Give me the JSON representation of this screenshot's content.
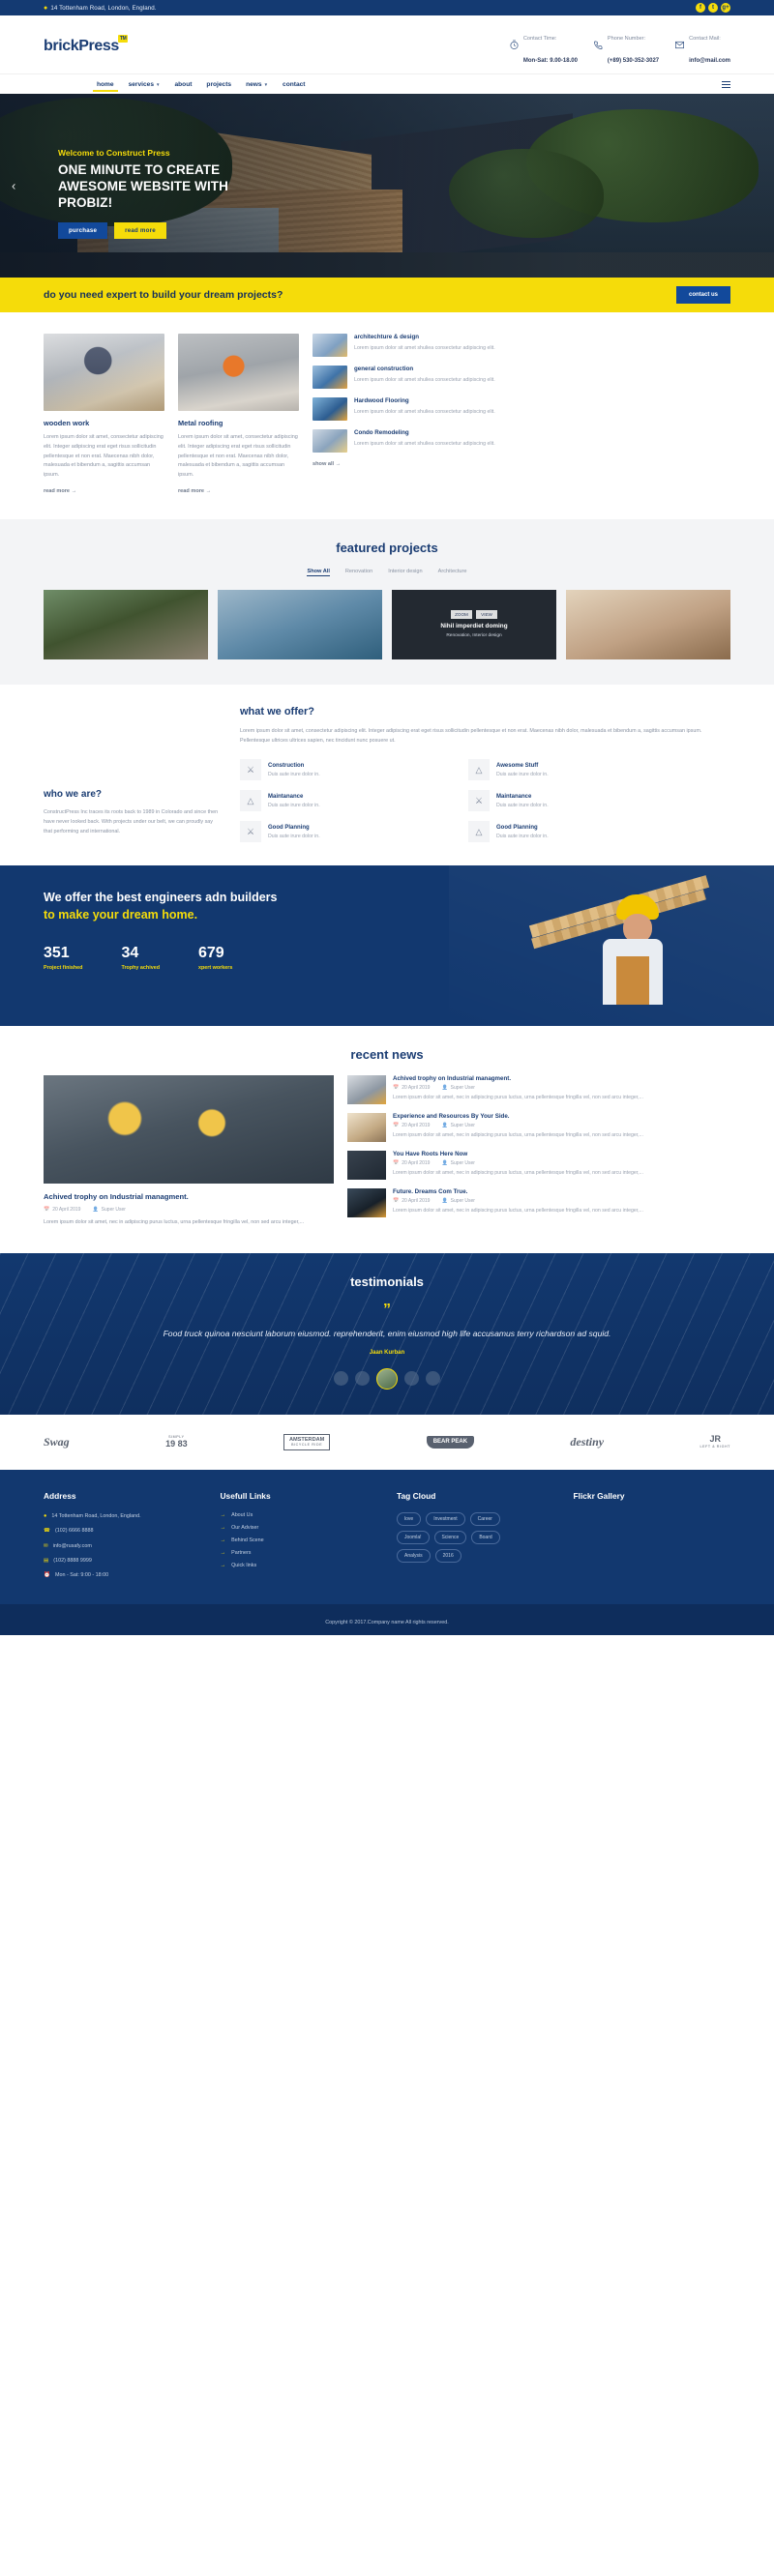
{
  "topbar": {
    "address": "14 Tottenham Road, London, England.",
    "socials": [
      {
        "name": "facebook-icon",
        "glyph": "f"
      },
      {
        "name": "twitter-icon",
        "glyph": "t"
      },
      {
        "name": "google-plus-icon",
        "glyph": "g+"
      }
    ]
  },
  "header": {
    "logo": "brickPress",
    "logo_tm": "TM",
    "info": [
      {
        "icon": "clock-icon",
        "label": "Contact Time:",
        "value": "Mon-Sat: 9.00-18.00"
      },
      {
        "icon": "phone-icon",
        "label": "Phone Number:",
        "value": "(+89) 530-352-3027"
      },
      {
        "icon": "mail-icon",
        "label": "Contact Mail:",
        "value": "info@mail.com"
      }
    ]
  },
  "nav": {
    "items": [
      {
        "label": "home",
        "caret": false,
        "active": true
      },
      {
        "label": "services",
        "caret": true,
        "active": false
      },
      {
        "label": "about",
        "caret": false,
        "active": false
      },
      {
        "label": "projects",
        "caret": false,
        "active": false
      },
      {
        "label": "news",
        "caret": true,
        "active": false
      },
      {
        "label": "contact",
        "caret": false,
        "active": false
      }
    ]
  },
  "hero": {
    "welcome": "Welcome to Construct Press",
    "headline": "ONE MINUTE TO CREATE AWESOME WEBSITE WITH PROBIZ!",
    "btn_primary": "purchase",
    "btn_secondary": "read more",
    "prev_arrow": "‹"
  },
  "cta": {
    "text": "do you need expert to build your dream projects?",
    "button": "contact us"
  },
  "services": {
    "cards": [
      {
        "title": "wooden work",
        "desc": "Lorem ipsum dolor sit amet, consectetur adipiscing elit. Integer adipiscing erat eget risus sollicitudin pellentesque et non erat. Maecenas nibh dolor, malesuada et bibendum a, sagittis accumsan ipsum.",
        "more": "read more →"
      },
      {
        "title": "Metal roofing",
        "desc": "Lorem ipsum dolor sit amet, consectetur adipiscing elit. Integer adipiscing erat eget risus sollicitudin pellentesque et non erat. Maecenas nibh dolor, malesuada et bibendum a, sagittis accumsan ipsum.",
        "more": "read more →"
      }
    ],
    "list": [
      {
        "title": "architechture & design",
        "desc": "Lorem ipsum dolor sit amet shuliea consectetur adipiscing elit."
      },
      {
        "title": "general construction",
        "desc": "Lorem ipsum dolor sit amet shuliea consectetur adipiscing elit."
      },
      {
        "title": "Hardwood Flooring",
        "desc": "Lorem ipsum dolor sit amet shuliea consectetur adipiscing elit."
      },
      {
        "title": "Condo Remodeling",
        "desc": "Lorem ipsum dolor sit amet shuliea consectetur adipiscing elit."
      }
    ],
    "show_all": "show all →"
  },
  "featured": {
    "title": "featured projects",
    "filters": [
      "Show All",
      "Renovation",
      "Interior design",
      "Architecture"
    ],
    "active_filter": "Show All",
    "projects": [
      {
        "name": "",
        "cat": ""
      },
      {
        "name": "",
        "cat": ""
      },
      {
        "name": "Nihil imperdiet doming",
        "cat": "Renovation, Interior design",
        "zoom": "ZOOM",
        "view": "VIEW"
      },
      {
        "name": "",
        "cat": ""
      }
    ]
  },
  "offer": {
    "left_title": "who we are?",
    "left_desc": "ConstructPress Inc traces its roots back to 1989 in Colorado and since then have never looked back. With projects under our belt, we can proudly say that performing and international.",
    "right_title": "what we offer?",
    "right_desc": "Lorem ipsum dolor sit amet, consectetur adipiscing elit. Integer adipiscing erat eget risus sollicitudin pellentesque et non erat. Maecenas nibh dolor, malesuada et bibendum a, sagittis accumsan ipsum. Pellentesque ultrices ultrices sapien, nec tincidunt nunc posuere ut.",
    "features": [
      {
        "icon": "award-icon",
        "title": "Construction",
        "desc": "Duis aute irure dolor in."
      },
      {
        "icon": "compass-icon",
        "title": "Awesome Stuff",
        "desc": "Duis aute irure dolor in."
      },
      {
        "icon": "compass-icon",
        "title": "Maintanance",
        "desc": "Duis aute irure dolor in."
      },
      {
        "icon": "award-icon",
        "title": "Maintanance",
        "desc": "Duis aute irure dolor in."
      },
      {
        "icon": "award-icon",
        "title": "Good Planning",
        "desc": "Duis aute irure dolor in."
      },
      {
        "icon": "compass-icon",
        "title": "Good Planning",
        "desc": "Duis aute irure dolor in."
      }
    ]
  },
  "stats": {
    "headline_1": "We offer the best engineers adn builders",
    "headline_2": "to make your dream home.",
    "counters": [
      {
        "num": "351",
        "label": "Project finished"
      },
      {
        "num": "34",
        "label": "Trophy achived"
      },
      {
        "num": "679",
        "label": "xpert workers"
      }
    ]
  },
  "news": {
    "title": "recent news",
    "main": {
      "title": "Achived trophy on Industrial managment.",
      "date": "20 April 2019",
      "author": "Super User",
      "desc": "Lorem ipsum dolor sit amet, nec in adipiscing purus luctus, urna pellentesque fringilla vel, non sed arcu integer,..."
    },
    "items": [
      {
        "title": "Achived trophy on Industrial managment.",
        "date": "20 April 2019",
        "author": "Super User",
        "desc": "Lorem ipsum dolor sit amet, nec in adipiscing purus luctus, urna pellentesque fringilla vel, non sed arcu integer,..."
      },
      {
        "title": "Experience and Resources By Your Side.",
        "date": "20 April 2019",
        "author": "Super User",
        "desc": "Lorem ipsum dolor sit amet, nec in adipiscing purus luctus, urna pellentesque fringilla vel, non sed arcu integer,..."
      },
      {
        "title": "You Have Roots Here Now",
        "date": "20 April 2019",
        "author": "Super User",
        "desc": "Lorem ipsum dolor sit amet, nec in adipiscing purus luctus, urna pellentesque fringilla vel, non sed arcu integer,..."
      },
      {
        "title": "Future. Dreams Com True.",
        "date": "20 April 2019",
        "author": "Super User",
        "desc": "Lorem ipsum dolor sit amet, nec in adipiscing purus luctus, urna pellentesque fringilla vel, non sed arcu integer,..."
      }
    ]
  },
  "testimonials": {
    "title": "testimonials",
    "quote_mark": "”",
    "quote": "Food truck quinoa nesciunt laborum eiusmod. reprehenderit, enim eiusmod high life accusamus terry richardson ad squid.",
    "author": "Jaan Kurban"
  },
  "brands": [
    {
      "name": "Swag",
      "sub": ""
    },
    {
      "name": "19   83",
      "sub": "SIMPLY"
    },
    {
      "name": "AMSTERDAM",
      "sub": "BICYCLE RIDE"
    },
    {
      "name": "BEAR PEAK",
      "sub": ""
    },
    {
      "name": "destiny",
      "sub": ""
    },
    {
      "name": "JR",
      "sub": "LEFT & RIGHT"
    }
  ],
  "footer": {
    "columns": [
      {
        "title": "Address",
        "type": "address",
        "items": [
          {
            "icon": "pin-icon",
            "text": "14 Tottenham Road, London, England."
          },
          {
            "icon": "phone-icon",
            "text": "(102) 6666 8888"
          },
          {
            "icon": "mail-icon",
            "text": "info@rusafy.com"
          },
          {
            "icon": "fax-icon",
            "text": "(102) 8888 9999"
          },
          {
            "icon": "clock-icon",
            "text": "Mon - Sat: 9:00 - 18:00"
          }
        ]
      },
      {
        "title": "Usefull Links",
        "type": "links",
        "items": [
          {
            "text": "About Us"
          },
          {
            "text": "Our Adviser"
          },
          {
            "text": "Behind Scene"
          },
          {
            "text": "Partners"
          },
          {
            "text": "Quick links"
          }
        ]
      },
      {
        "title": "Tag Cloud",
        "type": "tags",
        "items": [
          {
            "text": "love"
          },
          {
            "text": "Investment"
          },
          {
            "text": "Career"
          },
          {
            "text": "Joomla!"
          },
          {
            "text": "Science"
          },
          {
            "text": "Board"
          },
          {
            "text": "Analysis"
          },
          {
            "text": "2016"
          }
        ]
      },
      {
        "title": "Flickr Gallery",
        "type": "gallery",
        "items": []
      }
    ],
    "copyright": "Copyright © 2017.Company name All rights reserved."
  },
  "colors": {
    "navy": "#12386f",
    "yellow": "#f5dc0a",
    "blue": "#12499b",
    "dark_navy": "#0e2d5c"
  }
}
